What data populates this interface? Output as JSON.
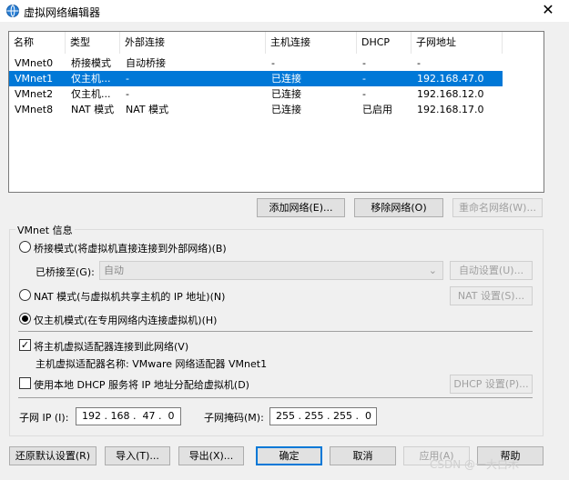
{
  "window": {
    "title": "虚拟网络编辑器",
    "close": "✕"
  },
  "table": {
    "headers": [
      "名称",
      "类型",
      "外部连接",
      "主机连接",
      "DHCP",
      "子网地址"
    ],
    "rows": [
      [
        "VMnet0",
        "桥接模式",
        "自动桥接",
        "-",
        "-",
        "-"
      ],
      [
        "VMnet1",
        "仅主机...",
        "-",
        "已连接",
        "-",
        "192.168.47.0"
      ],
      [
        "VMnet2",
        "仅主机...",
        "-",
        "已连接",
        "-",
        "192.168.12.0"
      ],
      [
        "VMnet8",
        "NAT 模式",
        "NAT 模式",
        "已连接",
        "已启用",
        "192.168.17.0"
      ]
    ],
    "selected_row": 1
  },
  "table_buttons": {
    "add": "添加网络(E)...",
    "remove": "移除网络(O)",
    "rename": "重命名网络(W)..."
  },
  "vmnet_info": {
    "title": "VMnet 信息",
    "bridged_label": "桥接模式(将虚拟机直接连接到外部网络)(B)",
    "bridged_to_label": "已桥接至(G):",
    "bridged_to_value": "自动",
    "auto_settings": "自动设置(U)...",
    "nat_label": "NAT 模式(与虚拟机共享主机的 IP 地址)(N)",
    "nat_settings": "NAT 设置(S)...",
    "hostonly_label": "仅主机模式(在专用网络内连接虚拟机)(H)",
    "connect_adapter_label": "将主机虚拟适配器连接到此网络(V)",
    "adapter_name_label": "主机虚拟适配器名称: VMware 网络适配器 VMnet1",
    "dhcp_label": "使用本地 DHCP 服务将 IP 地址分配给虚拟机(D)",
    "dhcp_settings": "DHCP 设置(P)...",
    "subnet_ip_label": "子网 IP (I):",
    "subnet_ip_value": "192 . 168 .  47 .  0",
    "subnet_mask_label": "子网掩码(M):",
    "subnet_mask_value": "255 . 255 . 255 .  0"
  },
  "footer": {
    "restore": "还原默认设置(R)",
    "import": "导入(T)...",
    "export": "导出(X)...",
    "ok": "确定",
    "cancel": "取消",
    "apply": "应用(A)",
    "help": "帮助"
  },
  "watermark": "CSDN @一大白木",
  "colors": {
    "selection": "#0078d7"
  }
}
